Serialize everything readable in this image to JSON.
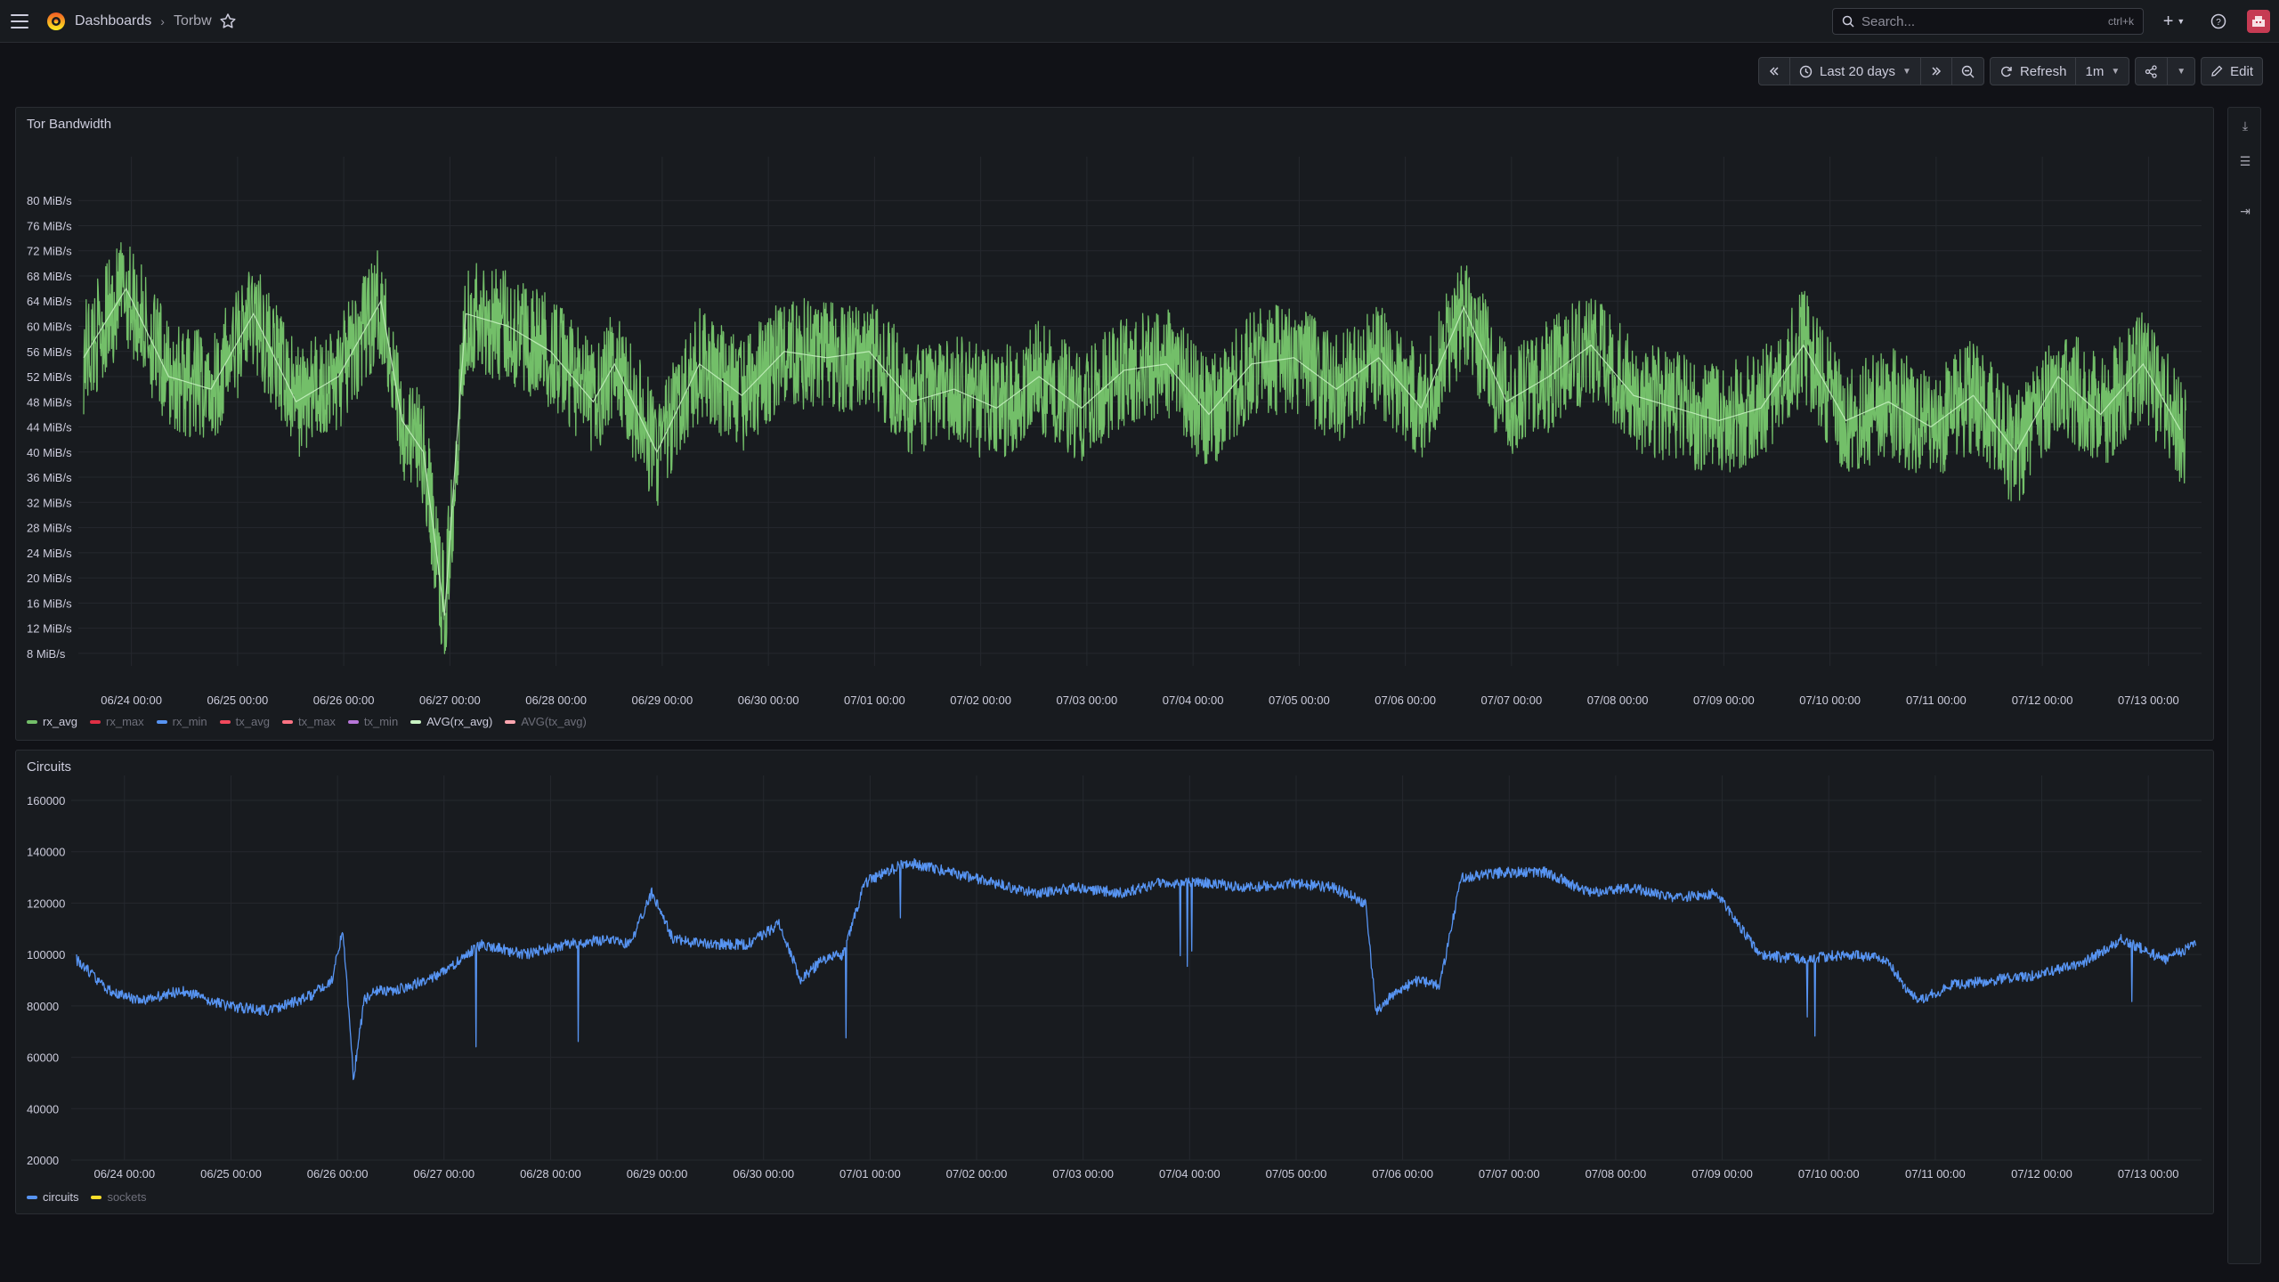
{
  "topbar": {
    "breadcrumb": [
      "Dashboards",
      "Torbw"
    ],
    "breadcrumb_sep": "›",
    "search_placeholder": "Search...",
    "search_shortcut": "ctrl+k"
  },
  "toolbar": {
    "time_range": "Last 20 days",
    "refresh_label": "Refresh",
    "refresh_interval": "1m",
    "edit_label": "Edit"
  },
  "chart_data": [
    {
      "title": "Tor Bandwidth",
      "type": "line",
      "ylabel": "",
      "xlabel": "",
      "y_unit": "MiB/s",
      "yticks": [
        "80 MiB/s",
        "76 MiB/s",
        "72 MiB/s",
        "68 MiB/s",
        "64 MiB/s",
        "60 MiB/s",
        "56 MiB/s",
        "52 MiB/s",
        "48 MiB/s",
        "44 MiB/s",
        "40 MiB/s",
        "36 MiB/s",
        "32 MiB/s",
        "28 MiB/s",
        "24 MiB/s",
        "20 MiB/s",
        "16 MiB/s",
        "12 MiB/s",
        "8 MiB/s"
      ],
      "ylim": [
        6,
        83
      ],
      "xticks": [
        "06/24 00:00",
        "06/25 00:00",
        "06/26 00:00",
        "06/27 00:00",
        "06/28 00:00",
        "06/29 00:00",
        "06/30 00:00",
        "07/01 00:00",
        "07/02 00:00",
        "07/03 00:00",
        "07/04 00:00",
        "07/05 00:00",
        "07/06 00:00",
        "07/07 00:00",
        "07/08 00:00",
        "07/09 00:00",
        "07/10 00:00",
        "07/11 00:00",
        "07/12 00:00",
        "07/13 00:00"
      ],
      "grid": true,
      "legend_position": "bottom-left",
      "series": [
        {
          "name": "rx_avg",
          "color": "#73bf69",
          "visible": true,
          "x_days": [
            0,
            0.4,
            0.8,
            1.2,
            1.6,
            2.0,
            2.4,
            2.8,
            3.0,
            3.2,
            3.4,
            3.6,
            4.0,
            4.4,
            4.8,
            5.0,
            5.4,
            5.8,
            6.2,
            6.6,
            7.0,
            7.4,
            7.8,
            8.2,
            8.6,
            9.0,
            9.4,
            9.8,
            10.2,
            10.6,
            11.0,
            11.4,
            11.8,
            12.2,
            12.6,
            13.0,
            13.4,
            13.8,
            14.2,
            14.6,
            15.0,
            15.4,
            15.8,
            16.2,
            16.6,
            17.0,
            17.4,
            17.8,
            18.2,
            18.6,
            19.0,
            19.4,
            19.8
          ],
          "values": [
            55,
            66,
            52,
            50,
            62,
            48,
            52,
            64,
            45,
            40,
            14,
            62,
            60,
            56,
            48,
            54,
            40,
            54,
            49,
            56,
            55,
            56,
            48,
            50,
            47,
            52,
            47,
            53,
            54,
            46,
            54,
            55,
            50,
            55,
            47,
            63,
            48,
            52,
            57,
            49,
            47,
            45,
            47,
            57,
            45,
            48,
            44,
            49,
            40,
            52,
            46,
            54,
            42
          ]
        },
        {
          "name": "rx_max",
          "color": "#e02f44",
          "visible": false
        },
        {
          "name": "rx_min",
          "color": "#5794f2",
          "visible": false
        },
        {
          "name": "tx_avg",
          "color": "#f2495c",
          "visible": false
        },
        {
          "name": "tx_max",
          "color": "#ff7383",
          "visible": false
        },
        {
          "name": "tx_min",
          "color": "#b877d9",
          "visible": false
        },
        {
          "name": "AVG(rx_avg)",
          "color": "#c8f2c2",
          "visible": true
        },
        {
          "name": "AVG(tx_avg)",
          "color": "#ffa6b0",
          "visible": false
        }
      ]
    },
    {
      "title": "Circuits",
      "type": "line",
      "ylabel": "",
      "xlabel": "",
      "yticks": [
        "160000",
        "140000",
        "120000",
        "100000",
        "80000",
        "60000",
        "40000",
        "20000"
      ],
      "ylim": [
        20000,
        160000
      ],
      "xticks": [
        "06/24 00:00",
        "06/25 00:00",
        "06/26 00:00",
        "06/27 00:00",
        "06/28 00:00",
        "06/29 00:00",
        "06/30 00:00",
        "07/01 00:00",
        "07/02 00:00",
        "07/03 00:00",
        "07/04 00:00",
        "07/05 00:00",
        "07/06 00:00",
        "07/07 00:00",
        "07/08 00:00",
        "07/09 00:00",
        "07/10 00:00",
        "07/11 00:00",
        "07/12 00:00",
        "07/13 00:00"
      ],
      "grid": true,
      "legend_position": "bottom-left",
      "series": [
        {
          "name": "circuits",
          "color": "#5794f2",
          "visible": true,
          "x_days": [
            0,
            0.3,
            0.6,
            1.0,
            1.4,
            1.8,
            2.2,
            2.4,
            2.5,
            2.6,
            2.7,
            2.8,
            3.0,
            3.4,
            3.8,
            4.2,
            4.6,
            5.0,
            5.2,
            5.4,
            5.6,
            5.9,
            6.3,
            6.6,
            6.8,
            7.0,
            7.2,
            7.4,
            7.6,
            7.8,
            8.2,
            8.6,
            9.0,
            9.4,
            9.8,
            10.2,
            10.6,
            11.0,
            11.4,
            11.8,
            12.1,
            12.2,
            12.4,
            12.6,
            12.8,
            13.0,
            13.4,
            13.8,
            14.2,
            14.6,
            15.0,
            15.4,
            15.8,
            16.2,
            16.6,
            17.0,
            17.2,
            17.3,
            17.6,
            18.0,
            18.4,
            18.8,
            19.2,
            19.6,
            19.9
          ],
          "values": [
            98000,
            86000,
            82000,
            86000,
            80000,
            78000,
            84000,
            90000,
            110000,
            52000,
            82000,
            86000,
            86000,
            92000,
            104000,
            100000,
            104000,
            106000,
            104000,
            124000,
            106000,
            104000,
            104000,
            112000,
            90000,
            98000,
            100000,
            128000,
            132000,
            136000,
            132000,
            128000,
            124000,
            126000,
            124000,
            128000,
            128000,
            126000,
            128000,
            126000,
            120000,
            78000,
            86000,
            90000,
            88000,
            130000,
            132000,
            132000,
            124000,
            126000,
            122000,
            124000,
            100000,
            98000,
            100000,
            98000,
            85000,
            82000,
            88000,
            90000,
            92000,
            96000,
            106000,
            98000,
            104000
          ]
        },
        {
          "name": "sockets",
          "color": "#fade2a",
          "visible": false
        }
      ]
    }
  ]
}
